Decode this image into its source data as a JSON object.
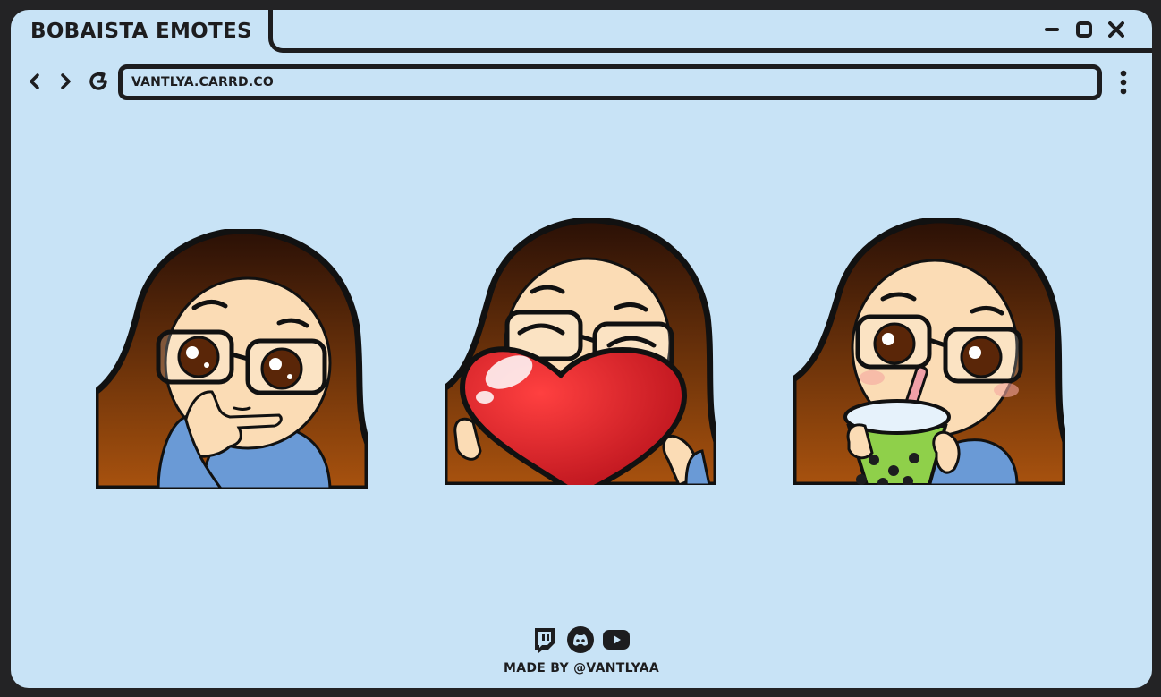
{
  "window": {
    "title": "BOBAISTA EMOTES",
    "address": "VANTLYA.CARRD.CO"
  },
  "colors": {
    "background": "#c8e3f6",
    "outline": "#1d1d1f",
    "hair": "#4a2410",
    "skin": "#fbdcb5",
    "sweater": "#6a9ad6",
    "heart": "#e8202a",
    "boba": "#8fd04a"
  },
  "emotes": [
    {
      "name": "thinking",
      "icon": "thinking-emote"
    },
    {
      "name": "heart",
      "icon": "heart-emote"
    },
    {
      "name": "boba",
      "icon": "boba-emote"
    }
  ],
  "socials": [
    {
      "icon": "twitch-icon"
    },
    {
      "icon": "discord-icon"
    },
    {
      "icon": "youtube-icon"
    }
  ],
  "footer": {
    "credit": "MADE BY @VANTLYAA"
  }
}
